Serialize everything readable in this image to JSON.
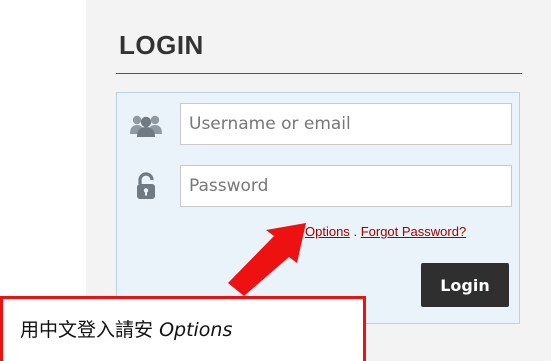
{
  "login": {
    "title": "LOGIN",
    "username_placeholder": "Username or email",
    "password_placeholder": "Password",
    "options_link": "Options",
    "separator": ".",
    "forgot_link": "Forgot Password?",
    "login_button": "Login",
    "icons": {
      "username": "users-icon",
      "password": "lock-icon"
    }
  },
  "annotation": {
    "chinese_text": "用中文登入請安",
    "options_text": "Options",
    "arrow_color": "#ee1111",
    "box_color": "#ee1111"
  }
}
